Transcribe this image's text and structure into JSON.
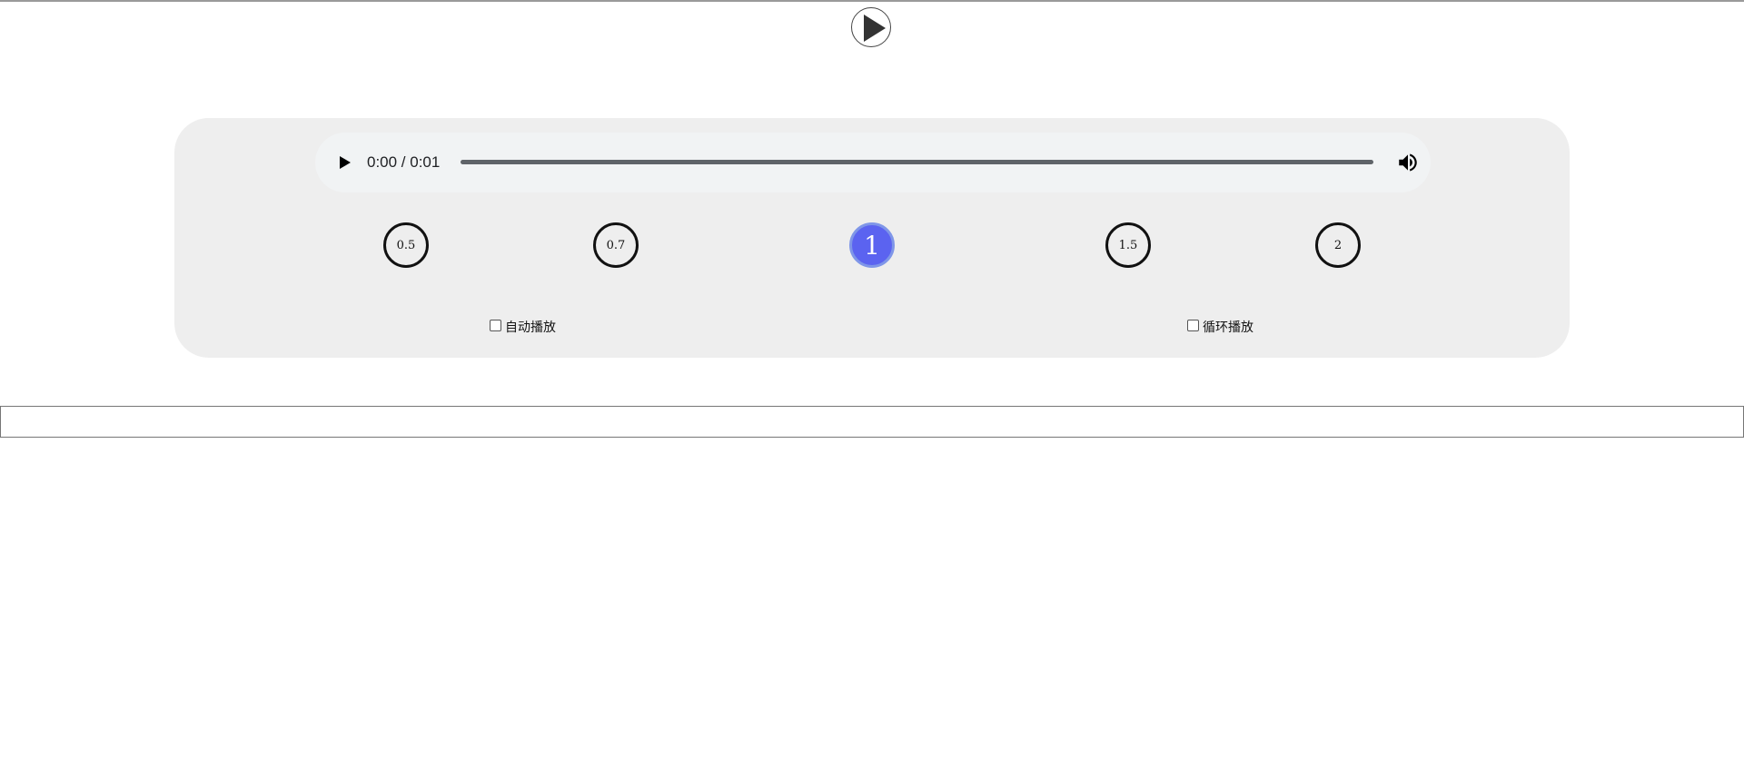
{
  "player": {
    "time_display": "0:00 / 0:01",
    "progress_fraction": 0
  },
  "speeds": {
    "options": [
      "0.5",
      "0.7",
      "1",
      "1.5",
      "2"
    ],
    "selected": "1"
  },
  "options": {
    "autoplay_label": "自动播放",
    "loop_label": "循环播放"
  },
  "input": {
    "value": "",
    "placeholder": ""
  },
  "colors": {
    "panel_bg": "#eeeeee",
    "player_bg": "#f1f3f4",
    "active_speed": "#5b63f0"
  },
  "icons": {
    "big_play": "play-circle-icon",
    "player_play": "play-icon",
    "volume": "volume-icon"
  }
}
